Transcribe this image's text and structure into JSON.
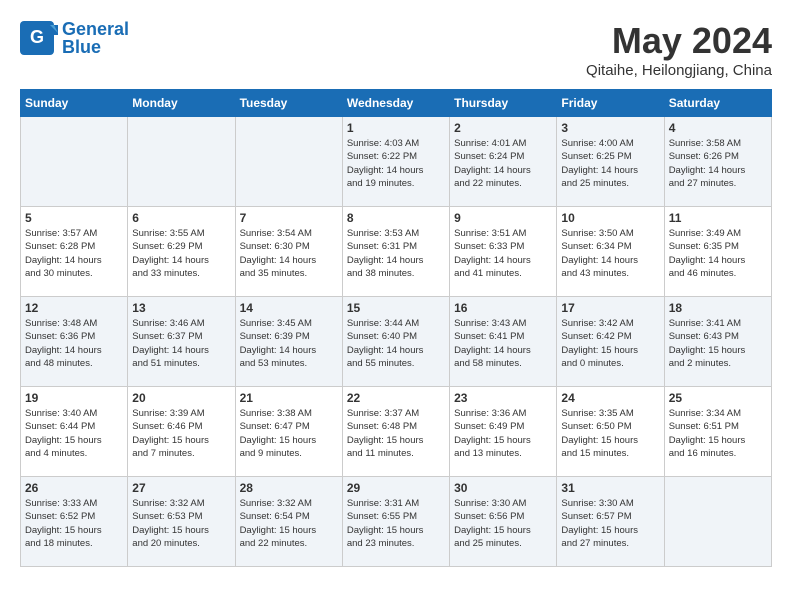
{
  "header": {
    "logo_line1": "General",
    "logo_line2": "Blue",
    "month": "May 2024",
    "location": "Qitaihe, Heilongjiang, China"
  },
  "weekdays": [
    "Sunday",
    "Monday",
    "Tuesday",
    "Wednesday",
    "Thursday",
    "Friday",
    "Saturday"
  ],
  "weeks": [
    [
      {
        "day": "",
        "info": ""
      },
      {
        "day": "",
        "info": ""
      },
      {
        "day": "",
        "info": ""
      },
      {
        "day": "1",
        "info": "Sunrise: 4:03 AM\nSunset: 6:22 PM\nDaylight: 14 hours\nand 19 minutes."
      },
      {
        "day": "2",
        "info": "Sunrise: 4:01 AM\nSunset: 6:24 PM\nDaylight: 14 hours\nand 22 minutes."
      },
      {
        "day": "3",
        "info": "Sunrise: 4:00 AM\nSunset: 6:25 PM\nDaylight: 14 hours\nand 25 minutes."
      },
      {
        "day": "4",
        "info": "Sunrise: 3:58 AM\nSunset: 6:26 PM\nDaylight: 14 hours\nand 27 minutes."
      }
    ],
    [
      {
        "day": "5",
        "info": "Sunrise: 3:57 AM\nSunset: 6:28 PM\nDaylight: 14 hours\nand 30 minutes."
      },
      {
        "day": "6",
        "info": "Sunrise: 3:55 AM\nSunset: 6:29 PM\nDaylight: 14 hours\nand 33 minutes."
      },
      {
        "day": "7",
        "info": "Sunrise: 3:54 AM\nSunset: 6:30 PM\nDaylight: 14 hours\nand 35 minutes."
      },
      {
        "day": "8",
        "info": "Sunrise: 3:53 AM\nSunset: 6:31 PM\nDaylight: 14 hours\nand 38 minutes."
      },
      {
        "day": "9",
        "info": "Sunrise: 3:51 AM\nSunset: 6:33 PM\nDaylight: 14 hours\nand 41 minutes."
      },
      {
        "day": "10",
        "info": "Sunrise: 3:50 AM\nSunset: 6:34 PM\nDaylight: 14 hours\nand 43 minutes."
      },
      {
        "day": "11",
        "info": "Sunrise: 3:49 AM\nSunset: 6:35 PM\nDaylight: 14 hours\nand 46 minutes."
      }
    ],
    [
      {
        "day": "12",
        "info": "Sunrise: 3:48 AM\nSunset: 6:36 PM\nDaylight: 14 hours\nand 48 minutes."
      },
      {
        "day": "13",
        "info": "Sunrise: 3:46 AM\nSunset: 6:37 PM\nDaylight: 14 hours\nand 51 minutes."
      },
      {
        "day": "14",
        "info": "Sunrise: 3:45 AM\nSunset: 6:39 PM\nDaylight: 14 hours\nand 53 minutes."
      },
      {
        "day": "15",
        "info": "Sunrise: 3:44 AM\nSunset: 6:40 PM\nDaylight: 14 hours\nand 55 minutes."
      },
      {
        "day": "16",
        "info": "Sunrise: 3:43 AM\nSunset: 6:41 PM\nDaylight: 14 hours\nand 58 minutes."
      },
      {
        "day": "17",
        "info": "Sunrise: 3:42 AM\nSunset: 6:42 PM\nDaylight: 15 hours\nand 0 minutes."
      },
      {
        "day": "18",
        "info": "Sunrise: 3:41 AM\nSunset: 6:43 PM\nDaylight: 15 hours\nand 2 minutes."
      }
    ],
    [
      {
        "day": "19",
        "info": "Sunrise: 3:40 AM\nSunset: 6:44 PM\nDaylight: 15 hours\nand 4 minutes."
      },
      {
        "day": "20",
        "info": "Sunrise: 3:39 AM\nSunset: 6:46 PM\nDaylight: 15 hours\nand 7 minutes."
      },
      {
        "day": "21",
        "info": "Sunrise: 3:38 AM\nSunset: 6:47 PM\nDaylight: 15 hours\nand 9 minutes."
      },
      {
        "day": "22",
        "info": "Sunrise: 3:37 AM\nSunset: 6:48 PM\nDaylight: 15 hours\nand 11 minutes."
      },
      {
        "day": "23",
        "info": "Sunrise: 3:36 AM\nSunset: 6:49 PM\nDaylight: 15 hours\nand 13 minutes."
      },
      {
        "day": "24",
        "info": "Sunrise: 3:35 AM\nSunset: 6:50 PM\nDaylight: 15 hours\nand 15 minutes."
      },
      {
        "day": "25",
        "info": "Sunrise: 3:34 AM\nSunset: 6:51 PM\nDaylight: 15 hours\nand 16 minutes."
      }
    ],
    [
      {
        "day": "26",
        "info": "Sunrise: 3:33 AM\nSunset: 6:52 PM\nDaylight: 15 hours\nand 18 minutes."
      },
      {
        "day": "27",
        "info": "Sunrise: 3:32 AM\nSunset: 6:53 PM\nDaylight: 15 hours\nand 20 minutes."
      },
      {
        "day": "28",
        "info": "Sunrise: 3:32 AM\nSunset: 6:54 PM\nDaylight: 15 hours\nand 22 minutes."
      },
      {
        "day": "29",
        "info": "Sunrise: 3:31 AM\nSunset: 6:55 PM\nDaylight: 15 hours\nand 23 minutes."
      },
      {
        "day": "30",
        "info": "Sunrise: 3:30 AM\nSunset: 6:56 PM\nDaylight: 15 hours\nand 25 minutes."
      },
      {
        "day": "31",
        "info": "Sunrise: 3:30 AM\nSunset: 6:57 PM\nDaylight: 15 hours\nand 27 minutes."
      },
      {
        "day": "",
        "info": ""
      }
    ]
  ]
}
